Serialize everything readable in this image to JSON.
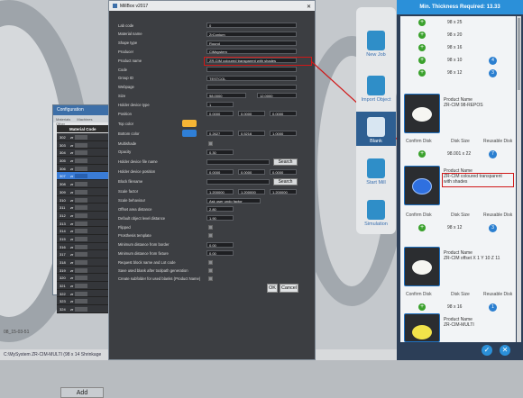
{
  "background": {
    "status_text": "C:\\MySystem ZR-CIM-MULTI (98 x 14 Shrinkage",
    "timestamp": "08_15-03-51"
  },
  "config_window": {
    "title": "Configuration",
    "tabs": [
      "Materials",
      "Machines",
      "Other"
    ],
    "column_header": "Material Code",
    "rows": [
      {
        "n": "302",
        "c": "zr"
      },
      {
        "n": "303",
        "c": "zr"
      },
      {
        "n": "304",
        "c": "zr"
      },
      {
        "n": "305",
        "c": "zr"
      },
      {
        "n": "306",
        "c": "zr"
      },
      {
        "n": "307",
        "c": "zr",
        "selected": true
      },
      {
        "n": "308",
        "c": "zr"
      },
      {
        "n": "309",
        "c": "zr"
      },
      {
        "n": "310",
        "c": "zr"
      },
      {
        "n": "311",
        "c": "zr"
      },
      {
        "n": "312",
        "c": "zr"
      },
      {
        "n": "313",
        "c": "zr"
      },
      {
        "n": "314",
        "c": "zr"
      },
      {
        "n": "315",
        "c": "zr"
      },
      {
        "n": "316",
        "c": "zr"
      },
      {
        "n": "317",
        "c": "zr"
      },
      {
        "n": "318",
        "c": "zr"
      },
      {
        "n": "319",
        "c": "zr"
      },
      {
        "n": "320",
        "c": "zr"
      },
      {
        "n": "321",
        "c": "zr"
      },
      {
        "n": "322",
        "c": "zr"
      },
      {
        "n": "323",
        "c": "zr"
      },
      {
        "n": "324",
        "c": "zr"
      }
    ],
    "add_label": "Add"
  },
  "dialog": {
    "title": "MillBox v2017",
    "close": "✕",
    "fields": [
      {
        "label": "Lab code",
        "value": "0"
      },
      {
        "label": "Material name",
        "value": "ZrConium"
      },
      {
        "label": "Shape type",
        "value": "Round"
      },
      {
        "label": "Producer",
        "value": "CiMsystem"
      },
      {
        "label": "Product name",
        "value": "ZR-CIM coloured transparent with shades"
      },
      {
        "label": "Code",
        "value": ""
      },
      {
        "label": "Group ID",
        "value": "TESTCOL"
      },
      {
        "label": "Webpage",
        "value": ""
      }
    ],
    "size_label": "Size",
    "size_values": [
      "98.0000",
      "12.0000"
    ],
    "holder_type_label": "Holder device type",
    "holder_type_value": "1",
    "position_label": "Position",
    "position_values": [
      "0.0000",
      "0.0000",
      "0.0000"
    ],
    "top_color_label": "Top color",
    "bottom_color_label": "Bottom color",
    "bottom_color_values": [
      "0.2627",
      "0.5216",
      "1.0000"
    ],
    "multishade_label": "Multishade",
    "opacity_label": "Opacity",
    "opacity_value": "0.30",
    "holder_file_label": "Holder device file name",
    "holder_pos_label": "Holder device position",
    "holder_pos_values": [
      "0.0000",
      "0.0000",
      "0.0000"
    ],
    "block_file_label": "Block filename",
    "search_label": "Search",
    "scale_label": "Scale factor",
    "scale_values": [
      "1.200000",
      "1.200000",
      "1.200000"
    ],
    "scale_behaviour_label": "Scale behaviour",
    "scale_behaviour_value": "Ask user undo factor",
    "offset_label": "Offset area distance",
    "offset_value": "2.80",
    "default_dist_label": "Default object level distance",
    "default_dist_value": "1.90",
    "flipped_label": "Flipped",
    "prosthesis_label": "Prosthesis template",
    "min_border_label": "Minimum distance from border",
    "min_border_value": "0.00",
    "min_fixture_label": "Minimum distance from fixture",
    "min_fixture_value": "0.00",
    "request_label": "Request block name and Lot code",
    "save_label": "Save used blank after toolpath generation",
    "create_label": "Create subfolder for used blanks (Product Name)",
    "ok_label": "OK",
    "cancel_label": "Cancel",
    "top_color": "#f5b535",
    "bottom_color": "#2f7fd6"
  },
  "toolbar": {
    "items": [
      {
        "label": "New Job",
        "icon": "new-job-icon"
      },
      {
        "label": "Import Object",
        "icon": "import-object-icon"
      },
      {
        "label": "Blank",
        "icon": "blank-icon",
        "active": true
      },
      {
        "label": "Start Mill",
        "icon": "start-mill-icon"
      },
      {
        "label": "Simulation",
        "icon": "simulation-icon"
      }
    ]
  },
  "right_panel": {
    "title": "Min. Thickness Required: 13.33",
    "top_sizes": [
      {
        "size": "98 x 25",
        "count": ""
      },
      {
        "size": "98 x 20",
        "count": ""
      },
      {
        "size": "98 x 16",
        "count": ""
      },
      {
        "size": "98 x 10",
        "count": "4"
      },
      {
        "size": "98 x 12",
        "count": "3"
      }
    ],
    "card1": {
      "pn_label": "Product Name",
      "pn_value": "ZR-CIM 98-REPOS",
      "confirm": "Confirm Disk",
      "disksize": "Disk Size",
      "reusable": "Reusable Disk",
      "size": "98.001 x 22",
      "count": "7"
    },
    "card2": {
      "pn_label": "Product Name",
      "pn_value": "ZR-CIM coloured transparent with shades",
      "confirm": "Confirm Disk",
      "disksize": "Disk Size",
      "reusable": "Reusable Disk",
      "size": "98 x 12",
      "count": "3"
    },
    "card3": {
      "pn_label": "Product Name",
      "pn_value": "ZR-CIM offset X 1 Y 10 Z 11",
      "confirm": "Confirm Disk",
      "disksize": "Disk Size",
      "reusable": "Reusable Disk",
      "size": "98 x 16",
      "count": "1"
    },
    "card4": {
      "pn_label": "Product Name",
      "pn_value": "ZR-CIM-MULTI"
    }
  },
  "colors": {
    "accent": "#2b90d9",
    "highlight": "#d01818"
  }
}
